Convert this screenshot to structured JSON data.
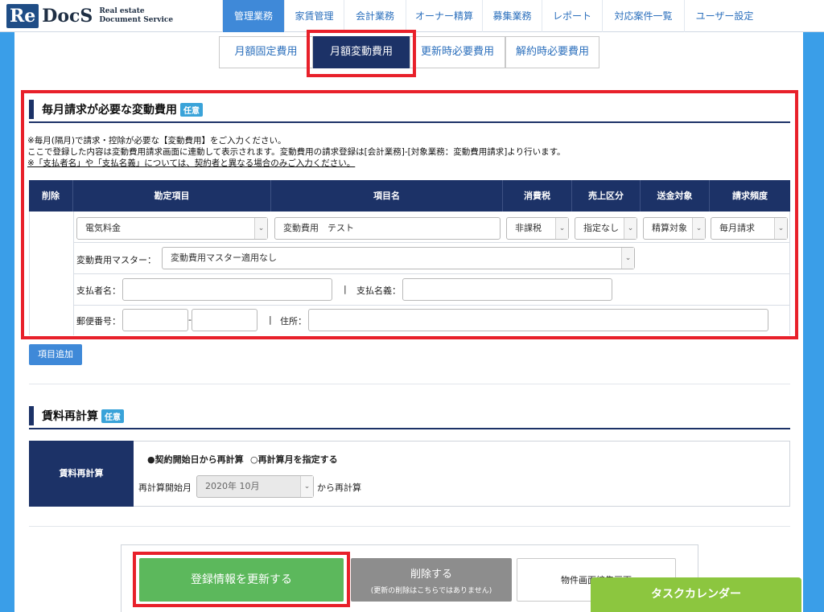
{
  "header": {
    "logo_re": "Re",
    "logo_docs": "DocS",
    "logo_sub1": "Real estate",
    "logo_sub2": "Document Service",
    "nav": [
      "管理業務",
      "家賃管理",
      "会計業務",
      "オーナー精算",
      "募集業務",
      "レポート",
      "対応案件一覧",
      "ユーザー設定"
    ],
    "active_nav": "管理業務"
  },
  "subtabs": [
    "月額固定費用",
    "月額変動費用",
    "更新時必要費用",
    "解約時必要費用"
  ],
  "variable_section": {
    "title": "毎月請求が必要な変動費用",
    "badge": "任意",
    "note1": "※毎月(隔月)で請求・控除が必要な【変動費用】をご入力ください。",
    "note2": "ここで登録した内容は変動費用請求画面に連動して表示されます。変動費用の請求登録は[会計業務]-[対象業務：変動費用請求]より行います。",
    "note3": "※「支払者名」や「支払名義」については、契約者と異なる場合のみご入力ください。",
    "columns": [
      "削除",
      "勘定項目",
      "項目名",
      "消費税",
      "売上区分",
      "送金対象",
      "請求頻度"
    ],
    "row": {
      "account": "電気料金",
      "item_name": "変動費用　テスト",
      "tax": "非課税",
      "sales_class": "指定なし",
      "remit": "精算対象",
      "frequency": "毎月請求"
    },
    "master_label": "変動費用マスター：",
    "master_value": "変動費用マスター適用なし",
    "payer_label": "支払者名：",
    "payer_value": "",
    "payee_sep": "|",
    "payee_label": "支払名義：",
    "payee_value": "",
    "postal_label": "郵便番号：",
    "postal_dash": "-",
    "address_sep": "|",
    "address_label": "住所："
  },
  "add_button": "項目追加",
  "recalc_section": {
    "title": "賃料再計算",
    "badge": "任意",
    "head": "賃料再計算",
    "radio1": "●契約開始日から再計算",
    "radio2": "○再計算月を指定する",
    "month_label": "再計算開始月",
    "month_value": "2020年 10月",
    "suffix": "から再計算"
  },
  "buttons": {
    "update": "登録情報を更新する",
    "delete": "削除する",
    "delete_sub": "(更新の削除はこちらではありません)",
    "property": "物件画面編集画面",
    "task_calendar": "タスクカレンダー"
  },
  "colors": {
    "navy": "#1c3267",
    "blue": "#3f89d8",
    "red": "#e8202a",
    "green": "#5cb85c",
    "lime": "#8cc63f"
  }
}
